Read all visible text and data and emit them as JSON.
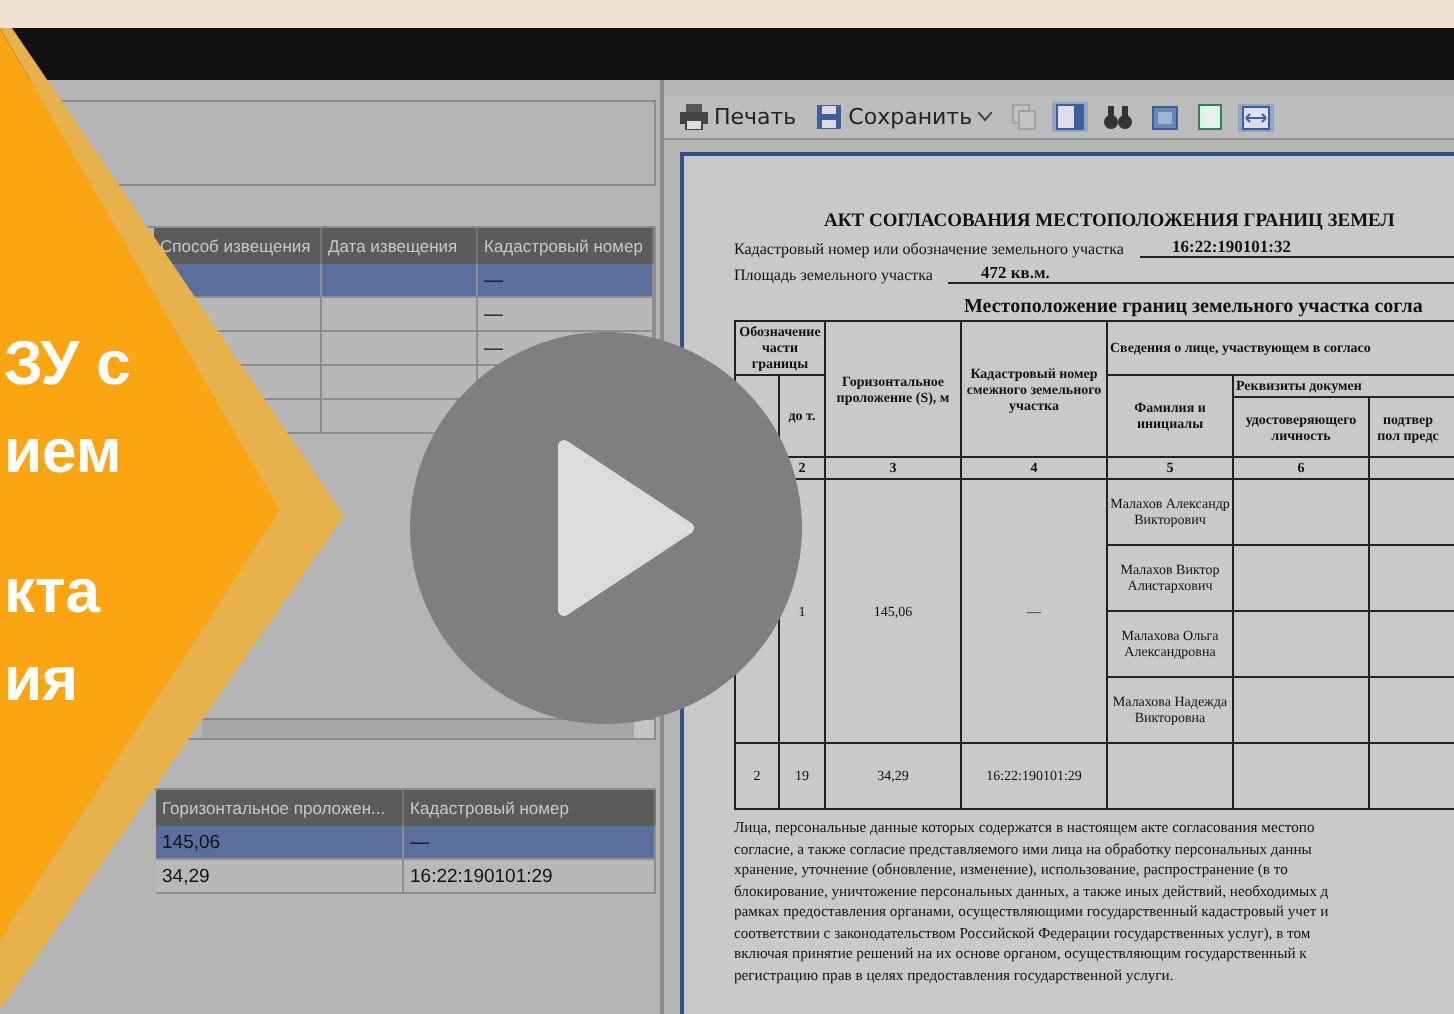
{
  "left_panel": {
    "notices_table": {
      "columns": [
        "Способ извещения",
        "Дата извещения",
        "Кадастровый номер"
      ],
      "rows": [
        {
          "cells": [
            "",
            "",
            "—"
          ],
          "selected": true
        },
        {
          "cells": [
            "",
            "",
            "—"
          ],
          "selected": false
        },
        {
          "cells": [
            "",
            "",
            "—"
          ],
          "selected": false
        },
        {
          "cells": [
            "",
            "",
            ""
          ],
          "selected": false
        },
        {
          "cells": [
            "",
            "",
            ""
          ],
          "selected": false
        }
      ]
    },
    "borders_table": {
      "columns": [
        "Горизонтальное проложен...",
        "Кадастровый номер"
      ],
      "rows": [
        {
          "cells": [
            "145,06",
            "—"
          ],
          "selected": true
        },
        {
          "cells": [
            "34,29",
            "16:22:190101:29"
          ],
          "selected": false
        }
      ]
    }
  },
  "toolbar": {
    "items": [
      {
        "kind": "print",
        "label": "Печать",
        "active": false,
        "disabled": false
      },
      {
        "kind": "save",
        "label": "Сохранить",
        "active": false,
        "disabled": false
      },
      {
        "kind": "copy",
        "active": false,
        "disabled": true
      },
      {
        "kind": "layout",
        "active": true,
        "disabled": false
      },
      {
        "kind": "find",
        "active": false,
        "disabled": false
      },
      {
        "kind": "page",
        "active": false,
        "disabled": false
      },
      {
        "kind": "single",
        "active": false,
        "disabled": false
      },
      {
        "kind": "fit",
        "active": true,
        "disabled": false
      }
    ]
  },
  "document": {
    "title": "АКТ СОГЛАСОВАНИЯ МЕСТОПОЛОЖЕНИЯ ГРАНИЦ ЗЕМЕЛ",
    "fields": [
      {
        "label": "Кадастровый номер или обозначение земельного участка",
        "value": "16:22:190101:32"
      },
      {
        "label": "Площадь земельного участка",
        "value": "472 кв.м."
      }
    ],
    "section_title": "Местоположение границ земельного участка согла",
    "headers": {
      "part": "Обозначение части границы",
      "to": "до т.",
      "length": "Горизонтальное проложение (S), м",
      "adjacent": "Кадастровый номер смежного земельного участка",
      "person_group": "Сведения о лице, участвующем в согласо",
      "name": "Фамилия и инициалы",
      "docs_group": "Реквизиты докумен",
      "identity": "удостоверяющего личность",
      "confirm": "подтвер пол предс"
    },
    "column_numbers": [
      "2",
      "3",
      "4",
      "5",
      "6"
    ],
    "rows": [
      {
        "part": "",
        "to": "1",
        "length": "145,06",
        "adjacent": "—",
        "names": [
          "Малахов Александр Викторович",
          "Малахов Виктор Алистархович",
          "Малахова Ольга Александровна",
          "Малахова Надежда Викторовна"
        ]
      },
      {
        "part": "2",
        "to": "19",
        "length": "34,29",
        "adjacent": "16:22:190101:29",
        "names": []
      }
    ],
    "note_lines": [
      "Лица, персональные данные которых содержатся в настоящем акте согласования местопо",
      "согласие, а также согласие представляемого ими лица на обработку персональных данны",
      "хранение, уточнение (обновление, изменение), использование, распространение (в то",
      "блокирование, уничтожение персональных данных, а также иных действий, необходимых д",
      "рамках предоставления органами, осуществляющими государственный кадастровый учет и",
      "соответствии с законодательством Российской Федерации государственных услуг), в том",
      "включая принятие решений на их основе органом, осуществляющим государственный к",
      "регистрацию прав в целях предоставления государственной услуги."
    ]
  },
  "banner": {
    "lines": [
      "ЗУ с",
      "ием",
      "кта",
      "ия"
    ]
  }
}
